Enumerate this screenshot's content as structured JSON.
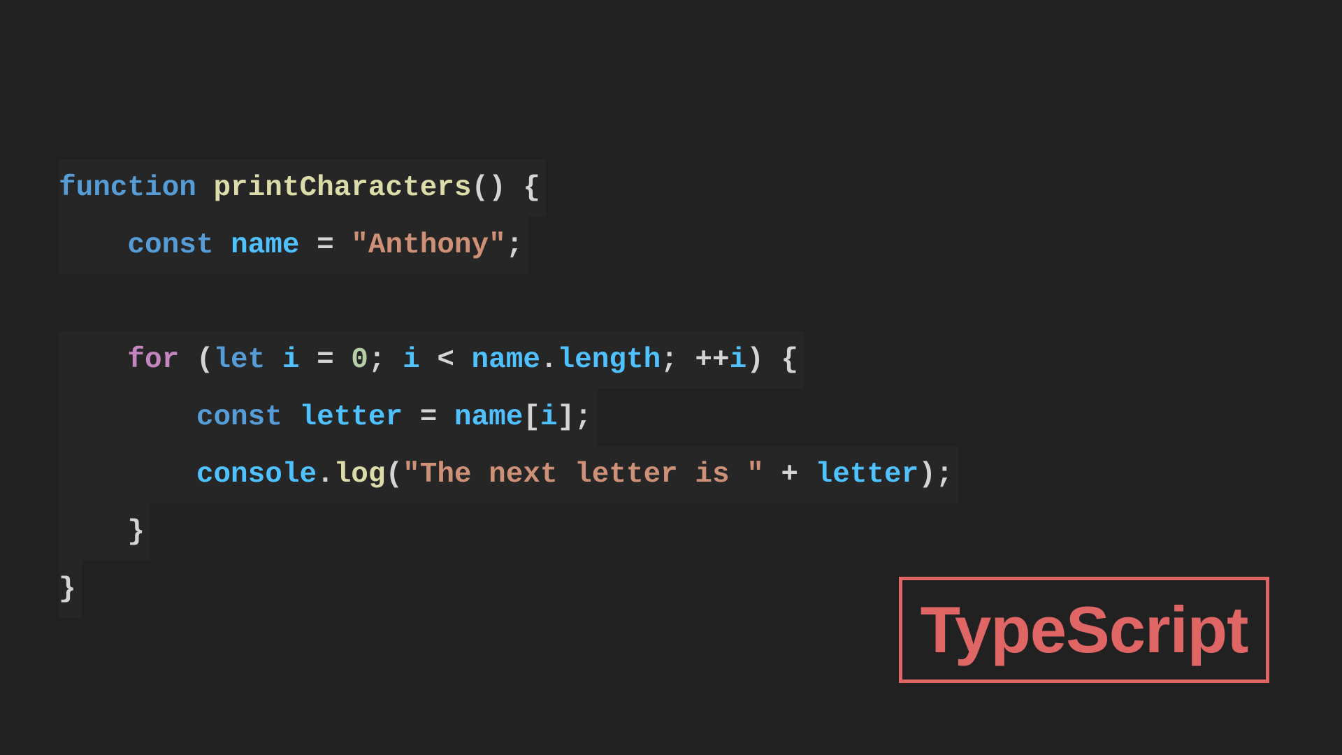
{
  "code": {
    "lines": [
      [
        {
          "t": "function",
          "c": "kw"
        },
        {
          "t": " ",
          "c": "punc"
        },
        {
          "t": "printCharacters",
          "c": "fn"
        },
        {
          "t": "() {",
          "c": "punc"
        }
      ],
      [
        {
          "t": "    ",
          "c": "punc"
        },
        {
          "t": "const",
          "c": "kw"
        },
        {
          "t": " ",
          "c": "punc"
        },
        {
          "t": "name",
          "c": "var"
        },
        {
          "t": " = ",
          "c": "punc"
        },
        {
          "t": "\"Anthony\"",
          "c": "str"
        },
        {
          "t": ";",
          "c": "punc"
        }
      ],
      [],
      [
        {
          "t": "    ",
          "c": "punc"
        },
        {
          "t": "for",
          "c": "ctrl"
        },
        {
          "t": " (",
          "c": "punc"
        },
        {
          "t": "let",
          "c": "kw"
        },
        {
          "t": " ",
          "c": "punc"
        },
        {
          "t": "i",
          "c": "var"
        },
        {
          "t": " = ",
          "c": "punc"
        },
        {
          "t": "0",
          "c": "num"
        },
        {
          "t": "; ",
          "c": "punc"
        },
        {
          "t": "i",
          "c": "var"
        },
        {
          "t": " < ",
          "c": "punc"
        },
        {
          "t": "name",
          "c": "var"
        },
        {
          "t": ".",
          "c": "punc"
        },
        {
          "t": "length",
          "c": "prop"
        },
        {
          "t": "; ++",
          "c": "punc"
        },
        {
          "t": "i",
          "c": "var"
        },
        {
          "t": ") {",
          "c": "punc"
        }
      ],
      [
        {
          "t": "        ",
          "c": "punc"
        },
        {
          "t": "const",
          "c": "kw"
        },
        {
          "t": " ",
          "c": "punc"
        },
        {
          "t": "letter",
          "c": "var"
        },
        {
          "t": " = ",
          "c": "punc"
        },
        {
          "t": "name",
          "c": "var"
        },
        {
          "t": "[",
          "c": "punc"
        },
        {
          "t": "i",
          "c": "var"
        },
        {
          "t": "];",
          "c": "punc"
        }
      ],
      [
        {
          "t": "        ",
          "c": "punc"
        },
        {
          "t": "console",
          "c": "var"
        },
        {
          "t": ".",
          "c": "punc"
        },
        {
          "t": "log",
          "c": "fn"
        },
        {
          "t": "(",
          "c": "punc"
        },
        {
          "t": "\"The next letter is \"",
          "c": "str"
        },
        {
          "t": " + ",
          "c": "punc"
        },
        {
          "t": "letter",
          "c": "var"
        },
        {
          "t": ");",
          "c": "punc"
        }
      ],
      [
        {
          "t": "    }",
          "c": "punc"
        }
      ],
      [
        {
          "t": "}",
          "c": "punc"
        }
      ]
    ]
  },
  "badge": {
    "label": "TypeScript",
    "color": "#e06666"
  },
  "colors": {
    "background": "#212121",
    "keyword": "#569cd6",
    "control": "#c586c0",
    "function": "#dcdcaa",
    "variable": "#4fc1ff",
    "string": "#ce9178",
    "number": "#b5cea8",
    "punctuation": "#d4d4d4"
  }
}
